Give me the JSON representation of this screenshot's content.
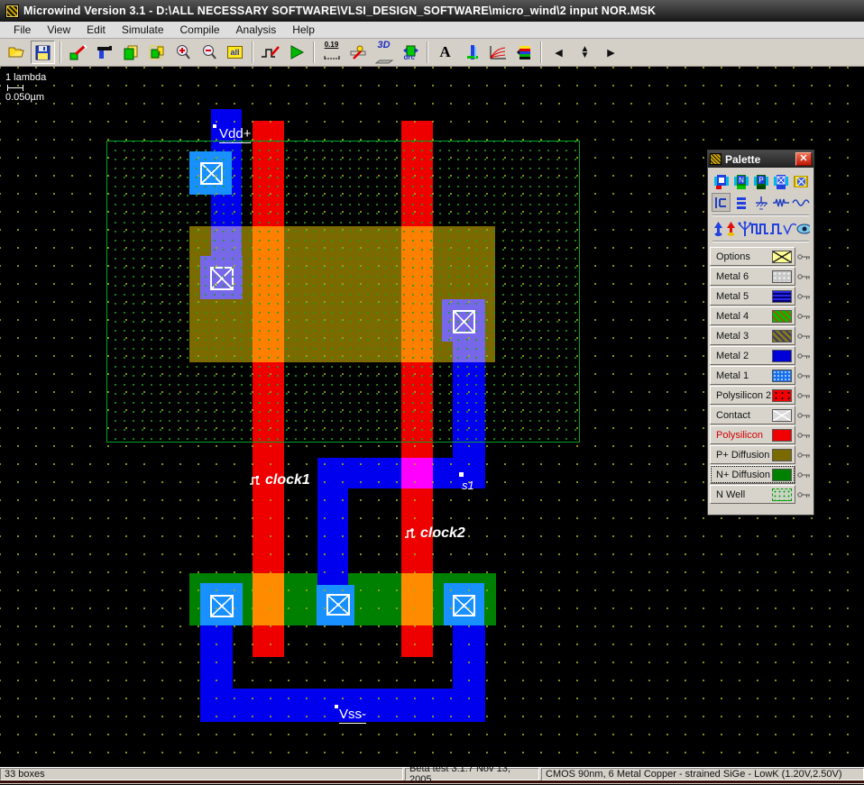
{
  "window": {
    "title": "Microwind Version 3.1 - D:\\ALL NECESSARY SOFTWARE\\VLSI_DESIGN_SOFTWARE\\micro_wind\\2 input NOR.MSK"
  },
  "menu": {
    "items": [
      "File",
      "View",
      "Edit",
      "Simulate",
      "Compile",
      "Analysis",
      "Help"
    ]
  },
  "toolbar": {
    "view_all_label": "all",
    "measure_label": "0.19",
    "threed_label": "3D",
    "drc_label": "drc",
    "text_tool_label": "A"
  },
  "scale": {
    "lambda_label": "1 lambda",
    "micron_label": "0.050µm"
  },
  "canvas_labels": {
    "vdd": "Vdd+",
    "clock1": "clock1",
    "clock2": "clock2",
    "s1": "s1",
    "vss": "Vss-"
  },
  "palette": {
    "title": "Palette",
    "n_contact_letter": "N",
    "p_contact_letter": "P",
    "layers": [
      {
        "label": "Options"
      },
      {
        "label": "Metal 6"
      },
      {
        "label": "Metal 5"
      },
      {
        "label": "Metal 4"
      },
      {
        "label": "Metal 3"
      },
      {
        "label": "Metal 2"
      },
      {
        "label": "Metal 1"
      },
      {
        "label": "Polysilicon 2"
      },
      {
        "label": "Contact"
      },
      {
        "label": "Polysilicon"
      },
      {
        "label": "P+ Diffusion"
      },
      {
        "label": "N+ Diffusion"
      },
      {
        "label": "N Well"
      }
    ],
    "selected_layer": "N+ Diffusion"
  },
  "statusbar": {
    "boxes": "33 boxes",
    "version": "Beta test 3.1.7 Nov 13, 2005",
    "process": "CMOS 90nm, 6 Metal Copper - strained SiGe - LowK (1.20V,2.50V)"
  },
  "colors": {
    "metal2_blue": "#0000EE",
    "via_metal1_blue": "#1890FF",
    "polysilicon_red": "#EE0000",
    "pplus_diffusion_brown": "#7A6A00",
    "nplus_diffusion_green": "#008000",
    "poly_over_diffusion_orange": "#FF7F00",
    "metal_over_poly_magenta": "#FF00FF",
    "metal_over_pdiff_violet": "#7668E8",
    "nwell_outline_green": "#00A426",
    "grid_dot_yellow": "#A8A818"
  }
}
